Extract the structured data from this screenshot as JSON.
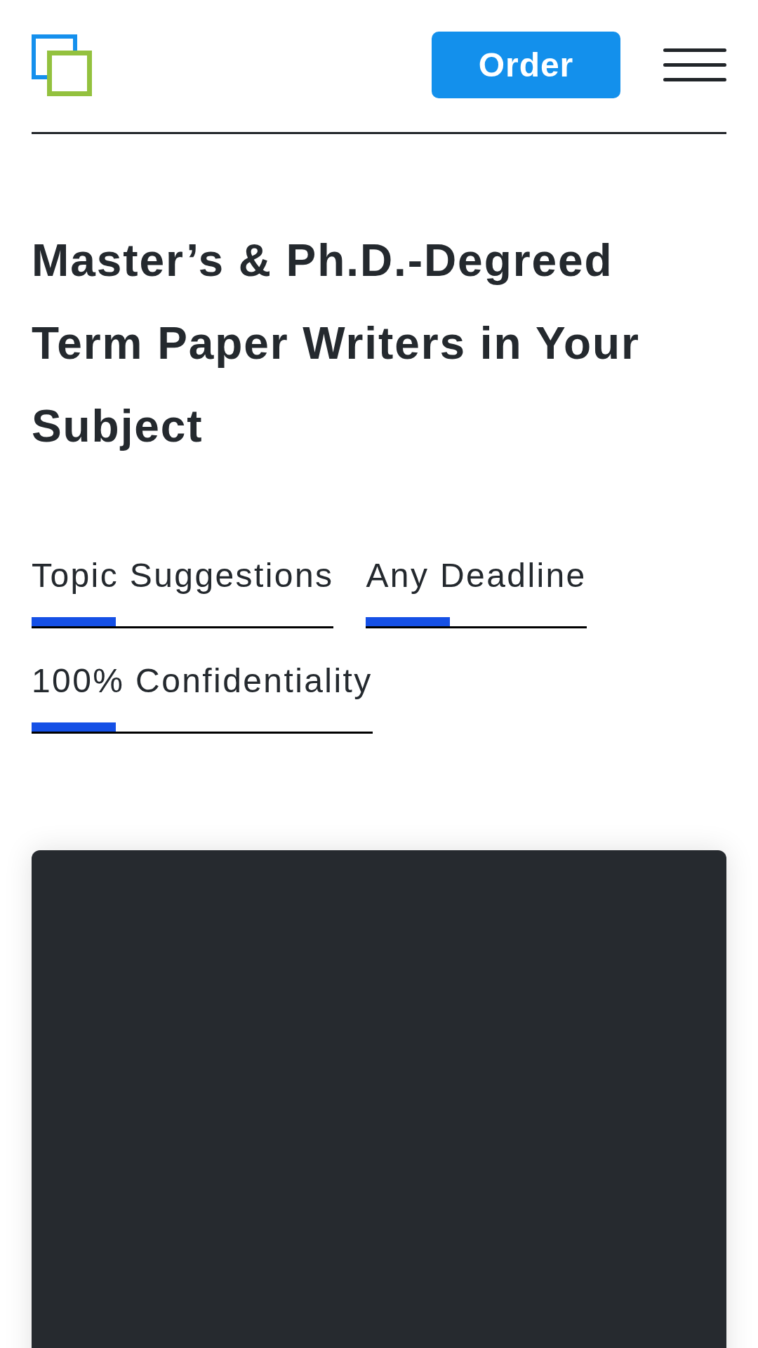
{
  "header": {
    "order_button": "Order"
  },
  "heading": "Master’s & Ph.D.-Degreed Term Paper Writers in Your Subject",
  "features": [
    "Topic Suggestions",
    "Any Deadline",
    "100% Confidentiality"
  ]
}
